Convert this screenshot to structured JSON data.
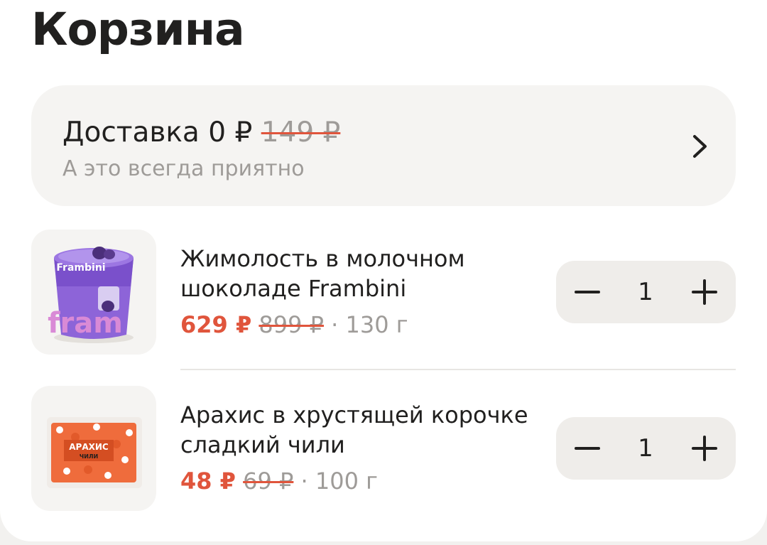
{
  "header": {
    "title": "Корзина"
  },
  "delivery": {
    "label": "Доставка",
    "price": "0 ₽",
    "old_price": "149 ₽",
    "subtitle": "А это всегда приятно",
    "chevron_icon": "chevron-right-icon"
  },
  "currency_sign": "₽",
  "colors": {
    "discount_price": "#e0553c",
    "muted_text": "#9e9b98",
    "primary_text": "#21201f",
    "panel_bg": "#f5f4f2"
  },
  "products": [
    {
      "name": "Жимолость в молочном шоколаде Frambini",
      "price": "629 ₽",
      "old_price": "899 ₽",
      "weight": "· 130 г",
      "quantity": "1",
      "image": "frambini-cup-image",
      "image_text": "Frambini"
    },
    {
      "name": "Арахис в хрустящей корочке сладкий чили",
      "price": "48 ₽",
      "old_price": "69 ₽",
      "weight": "· 100 г",
      "quantity": "1",
      "image": "peanut-bag-image",
      "image_text": "АРАХИС ЧИЛИ"
    }
  ],
  "stepper": {
    "minus_icon": "minus-icon",
    "plus_icon": "plus-icon"
  }
}
